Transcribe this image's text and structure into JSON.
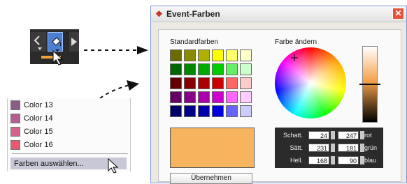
{
  "menu": {
    "items": [
      {
        "label": "Color 13",
        "color": "#8b5c8a"
      },
      {
        "label": "Color 14",
        "color": "#b35f92"
      },
      {
        "label": "Color 15",
        "color": "#d8608d"
      },
      {
        "label": "Color 16",
        "color": "#e35b6d"
      }
    ],
    "choose_label": "Farben auswählen..."
  },
  "dialog": {
    "title": "Event-Farben",
    "standard_colors_label": "Standardfarben",
    "change_color_label": "Farbe ändern",
    "apply_label": "Übernehmen",
    "swatches": [
      "#6b6b00",
      "#8b8b00",
      "#b0b000",
      "#ffff00",
      "#ffff66",
      "#ffffcc",
      "#006600",
      "#008800",
      "#00aa00",
      "#00cc00",
      "#66ee66",
      "#ccffcc",
      "#660000",
      "#880000",
      "#aa0000",
      "#cc0000",
      "#ff6666",
      "#ffcccc",
      "#660066",
      "#880088",
      "#aa00aa",
      "#cc00cc",
      "#ff66ff",
      "#ffccff",
      "#000066",
      "#000088",
      "#0000aa",
      "#0000dd",
      "#6666ff",
      "#ccccff"
    ],
    "preview_color": "#f7b45f",
    "values": [
      {
        "label": "Schatt.",
        "left": "24",
        "right": "247",
        "name": "rot"
      },
      {
        "label": "Sätt.",
        "left": "231",
        "right": "181",
        "name": "grün"
      },
      {
        "label": "Hell.",
        "left": "168",
        "right": "90",
        "name": "blau"
      }
    ]
  }
}
